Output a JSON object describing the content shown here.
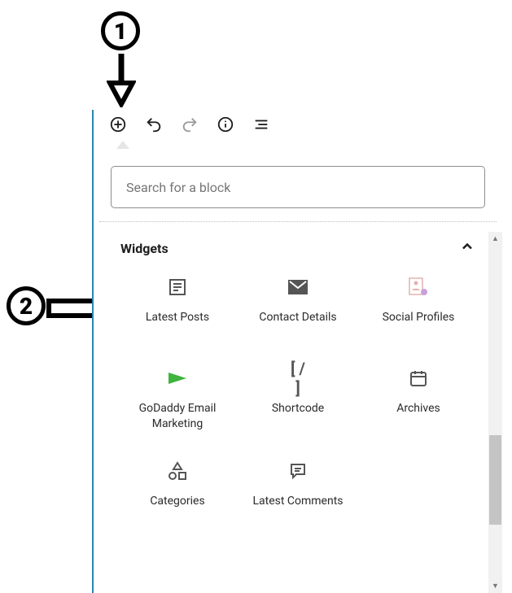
{
  "annotations": {
    "one": "1",
    "two": "2"
  },
  "toolbar": {
    "add": "Add block",
    "undo": "Undo",
    "redo": "Redo",
    "info": "Info",
    "outline": "Outline"
  },
  "search": {
    "placeholder": "Search for a block"
  },
  "section": {
    "title": "Widgets"
  },
  "blocks": [
    {
      "label": "Latest Posts",
      "icon": "latest-posts"
    },
    {
      "label": "Contact Details",
      "icon": "contact-details"
    },
    {
      "label": "Social Profiles",
      "icon": "social-profiles"
    },
    {
      "label": "GoDaddy Email Marketing",
      "icon": "godaddy"
    },
    {
      "label": "Shortcode",
      "icon": "shortcode"
    },
    {
      "label": "Archives",
      "icon": "archives"
    },
    {
      "label": "Categories",
      "icon": "categories"
    },
    {
      "label": "Latest Comments",
      "icon": "latest-comments"
    }
  ]
}
